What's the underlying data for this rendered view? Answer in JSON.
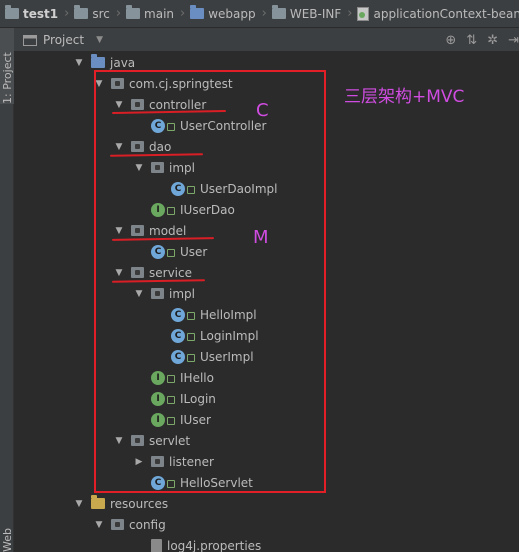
{
  "breadcrumb": [
    {
      "label": "test1",
      "icon": "folder-icon"
    },
    {
      "label": "src",
      "icon": "folder-icon"
    },
    {
      "label": "main",
      "icon": "folder-icon"
    },
    {
      "label": "webapp",
      "icon": "web-folder-icon"
    },
    {
      "label": "WEB-INF",
      "icon": "folder-icon"
    },
    {
      "label": "applicationContext-bean.xml",
      "icon": "xml-file-icon"
    }
  ],
  "side_tabs": {
    "project": "1: Project",
    "web": "Web"
  },
  "project_panel": {
    "view_label": "Project"
  },
  "tree": [
    {
      "label": "java",
      "icon": "folder",
      "expanded": true
    },
    {
      "label": "com.cj.springtest",
      "icon": "package",
      "expanded": true
    },
    {
      "label": "controller",
      "icon": "package",
      "expanded": true
    },
    {
      "label": "UserController",
      "icon": "class"
    },
    {
      "label": "dao",
      "icon": "package",
      "expanded": true
    },
    {
      "label": "impl",
      "icon": "package",
      "expanded": true
    },
    {
      "label": "UserDaoImpl",
      "icon": "class"
    },
    {
      "label": "IUserDao",
      "icon": "interface"
    },
    {
      "label": "model",
      "icon": "package",
      "expanded": true
    },
    {
      "label": "User",
      "icon": "class"
    },
    {
      "label": "service",
      "icon": "package",
      "expanded": true
    },
    {
      "label": "impl",
      "icon": "package",
      "expanded": true
    },
    {
      "label": "HelloImpl",
      "icon": "class"
    },
    {
      "label": "LoginImpl",
      "icon": "class"
    },
    {
      "label": "UserImpl",
      "icon": "class"
    },
    {
      "label": "IHello",
      "icon": "interface"
    },
    {
      "label": "ILogin",
      "icon": "interface"
    },
    {
      "label": "IUser",
      "icon": "interface"
    },
    {
      "label": "servlet",
      "icon": "package",
      "expanded": true
    },
    {
      "label": "listener",
      "icon": "package",
      "expanded": false
    },
    {
      "label": "HelloServlet",
      "icon": "class"
    },
    {
      "label": "resources",
      "icon": "resources-folder",
      "expanded": true
    },
    {
      "label": "config",
      "icon": "package",
      "expanded": true
    },
    {
      "label": "log4j.properties",
      "icon": "properties-file"
    }
  ],
  "annotations": {
    "title": "三层架构+MVC",
    "controller_mark": "C",
    "model_mark": "M"
  },
  "colors": {
    "annotation_box": "#e21f26",
    "annotation_text": "#d04ce1",
    "class_icon": "#6fa7d8",
    "interface_icon": "#6aa860"
  }
}
